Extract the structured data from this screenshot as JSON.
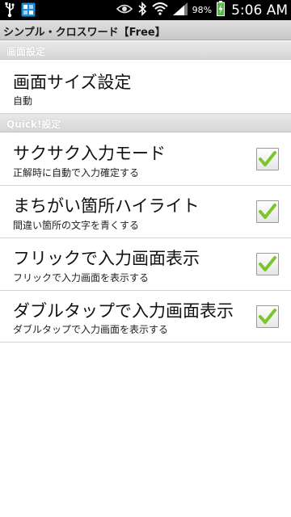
{
  "status_bar": {
    "battery_percent": "98%",
    "time": "5:06 AM",
    "icons": [
      "usb-icon",
      "app-notification-icon",
      "eye-icon",
      "bluetooth-icon",
      "wifi-icon",
      "signal-icon",
      "battery-charging-icon"
    ]
  },
  "title_bar": {
    "title": "シンプル・クロスワード【Free】"
  },
  "sections": {
    "display": {
      "header": "画面設定",
      "screen_size": {
        "title": "画面サイズ設定",
        "summary": "自動"
      }
    },
    "quick": {
      "header": "Quick!設定",
      "items": [
        {
          "title": "サクサク入力モード",
          "summary": "正解時に自動で入力確定する",
          "checked": true
        },
        {
          "title": "まちがい箇所ハイライト",
          "summary": "間違い箇所の文字を青くする",
          "checked": true
        },
        {
          "title": "フリックで入力画面表示",
          "summary": "フリックで入力画面を表示する",
          "checked": true
        },
        {
          "title": "ダブルタップで入力画面表示",
          "summary": "ダブルタップで入力画面を表示する",
          "checked": true
        }
      ]
    }
  },
  "colors": {
    "check_green": "#7cc52a",
    "status_bar_bg": "#000000",
    "battery_green": "#54b948"
  }
}
